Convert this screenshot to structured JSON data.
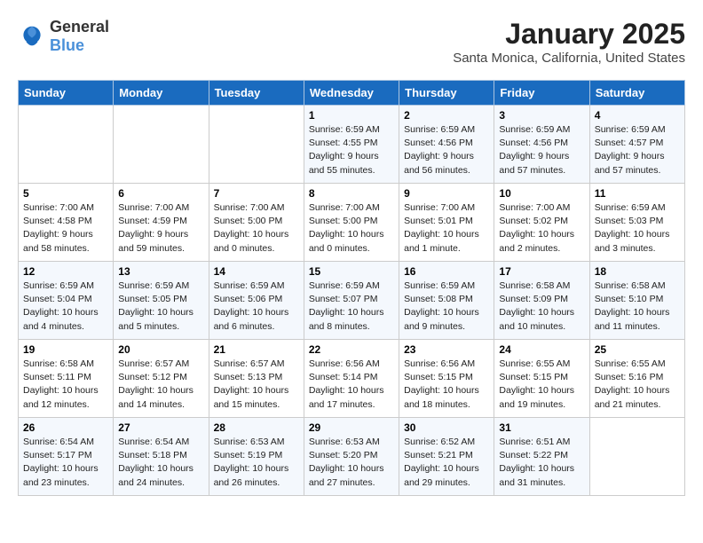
{
  "header": {
    "logo": {
      "text_general": "General",
      "text_blue": "Blue"
    },
    "title": "January 2025",
    "location": "Santa Monica, California, United States"
  },
  "calendar": {
    "weekdays": [
      "Sunday",
      "Monday",
      "Tuesday",
      "Wednesday",
      "Thursday",
      "Friday",
      "Saturday"
    ],
    "weeks": [
      [
        {
          "day": "",
          "info": ""
        },
        {
          "day": "",
          "info": ""
        },
        {
          "day": "",
          "info": ""
        },
        {
          "day": "1",
          "info": "Sunrise: 6:59 AM\nSunset: 4:55 PM\nDaylight: 9 hours\nand 55 minutes."
        },
        {
          "day": "2",
          "info": "Sunrise: 6:59 AM\nSunset: 4:56 PM\nDaylight: 9 hours\nand 56 minutes."
        },
        {
          "day": "3",
          "info": "Sunrise: 6:59 AM\nSunset: 4:56 PM\nDaylight: 9 hours\nand 57 minutes."
        },
        {
          "day": "4",
          "info": "Sunrise: 6:59 AM\nSunset: 4:57 PM\nDaylight: 9 hours\nand 57 minutes."
        }
      ],
      [
        {
          "day": "5",
          "info": "Sunrise: 7:00 AM\nSunset: 4:58 PM\nDaylight: 9 hours\nand 58 minutes."
        },
        {
          "day": "6",
          "info": "Sunrise: 7:00 AM\nSunset: 4:59 PM\nDaylight: 9 hours\nand 59 minutes."
        },
        {
          "day": "7",
          "info": "Sunrise: 7:00 AM\nSunset: 5:00 PM\nDaylight: 10 hours\nand 0 minutes."
        },
        {
          "day": "8",
          "info": "Sunrise: 7:00 AM\nSunset: 5:00 PM\nDaylight: 10 hours\nand 0 minutes."
        },
        {
          "day": "9",
          "info": "Sunrise: 7:00 AM\nSunset: 5:01 PM\nDaylight: 10 hours\nand 1 minute."
        },
        {
          "day": "10",
          "info": "Sunrise: 7:00 AM\nSunset: 5:02 PM\nDaylight: 10 hours\nand 2 minutes."
        },
        {
          "day": "11",
          "info": "Sunrise: 6:59 AM\nSunset: 5:03 PM\nDaylight: 10 hours\nand 3 minutes."
        }
      ],
      [
        {
          "day": "12",
          "info": "Sunrise: 6:59 AM\nSunset: 5:04 PM\nDaylight: 10 hours\nand 4 minutes."
        },
        {
          "day": "13",
          "info": "Sunrise: 6:59 AM\nSunset: 5:05 PM\nDaylight: 10 hours\nand 5 minutes."
        },
        {
          "day": "14",
          "info": "Sunrise: 6:59 AM\nSunset: 5:06 PM\nDaylight: 10 hours\nand 6 minutes."
        },
        {
          "day": "15",
          "info": "Sunrise: 6:59 AM\nSunset: 5:07 PM\nDaylight: 10 hours\nand 8 minutes."
        },
        {
          "day": "16",
          "info": "Sunrise: 6:59 AM\nSunset: 5:08 PM\nDaylight: 10 hours\nand 9 minutes."
        },
        {
          "day": "17",
          "info": "Sunrise: 6:58 AM\nSunset: 5:09 PM\nDaylight: 10 hours\nand 10 minutes."
        },
        {
          "day": "18",
          "info": "Sunrise: 6:58 AM\nSunset: 5:10 PM\nDaylight: 10 hours\nand 11 minutes."
        }
      ],
      [
        {
          "day": "19",
          "info": "Sunrise: 6:58 AM\nSunset: 5:11 PM\nDaylight: 10 hours\nand 12 minutes."
        },
        {
          "day": "20",
          "info": "Sunrise: 6:57 AM\nSunset: 5:12 PM\nDaylight: 10 hours\nand 14 minutes."
        },
        {
          "day": "21",
          "info": "Sunrise: 6:57 AM\nSunset: 5:13 PM\nDaylight: 10 hours\nand 15 minutes."
        },
        {
          "day": "22",
          "info": "Sunrise: 6:56 AM\nSunset: 5:14 PM\nDaylight: 10 hours\nand 17 minutes."
        },
        {
          "day": "23",
          "info": "Sunrise: 6:56 AM\nSunset: 5:15 PM\nDaylight: 10 hours\nand 18 minutes."
        },
        {
          "day": "24",
          "info": "Sunrise: 6:55 AM\nSunset: 5:15 PM\nDaylight: 10 hours\nand 19 minutes."
        },
        {
          "day": "25",
          "info": "Sunrise: 6:55 AM\nSunset: 5:16 PM\nDaylight: 10 hours\nand 21 minutes."
        }
      ],
      [
        {
          "day": "26",
          "info": "Sunrise: 6:54 AM\nSunset: 5:17 PM\nDaylight: 10 hours\nand 23 minutes."
        },
        {
          "day": "27",
          "info": "Sunrise: 6:54 AM\nSunset: 5:18 PM\nDaylight: 10 hours\nand 24 minutes."
        },
        {
          "day": "28",
          "info": "Sunrise: 6:53 AM\nSunset: 5:19 PM\nDaylight: 10 hours\nand 26 minutes."
        },
        {
          "day": "29",
          "info": "Sunrise: 6:53 AM\nSunset: 5:20 PM\nDaylight: 10 hours\nand 27 minutes."
        },
        {
          "day": "30",
          "info": "Sunrise: 6:52 AM\nSunset: 5:21 PM\nDaylight: 10 hours\nand 29 minutes."
        },
        {
          "day": "31",
          "info": "Sunrise: 6:51 AM\nSunset: 5:22 PM\nDaylight: 10 hours\nand 31 minutes."
        },
        {
          "day": "",
          "info": ""
        }
      ]
    ]
  }
}
